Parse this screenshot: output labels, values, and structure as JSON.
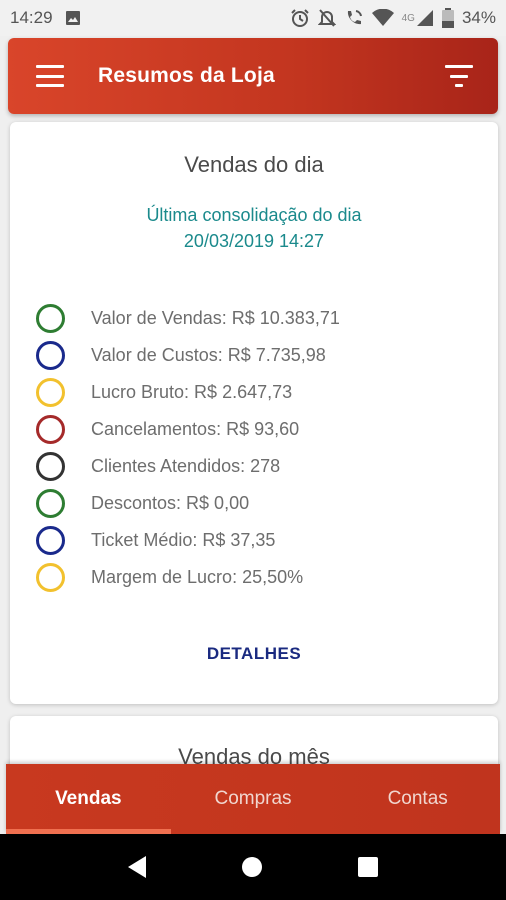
{
  "status_bar": {
    "time": "14:29",
    "battery": "34%",
    "network": "4G",
    "icons": [
      "image-icon",
      "alarm-icon",
      "notifications-off-icon",
      "wifi-call-icon",
      "wifi-icon",
      "signal-icon",
      "battery-icon"
    ]
  },
  "app_bar": {
    "title": "Resumos da Loja",
    "menu_icon": "menu-icon",
    "filter_icon": "filter-icon"
  },
  "daily_card": {
    "title": "Vendas do dia",
    "consolidation_label": "Última consolidação do dia",
    "consolidation_datetime": "20/03/2019 14:27",
    "metrics": [
      {
        "label": "Valor de Vendas: R$ 10.383,71",
        "color": "#2e7d32"
      },
      {
        "label": "Valor de Custos: R$ 7.735,98",
        "color": "#1a2a8c"
      },
      {
        "label": "Lucro Bruto: R$ 2.647,73",
        "color": "#f2c12e"
      },
      {
        "label": "Cancelamentos: R$ 93,60",
        "color": "#a52a2a"
      },
      {
        "label": "Clientes Atendidos: 278",
        "color": "#333333"
      },
      {
        "label": "Descontos: R$ 0,00",
        "color": "#2e7d32"
      },
      {
        "label": "Ticket Médio: R$ 37,35",
        "color": "#1a2a8c"
      },
      {
        "label": "Margem de Lucro: 25,50%",
        "color": "#f2c12e"
      }
    ],
    "details_button": "DETALHES"
  },
  "monthly_card": {
    "title": "Vendas do mês"
  },
  "bottom_nav": {
    "tabs": [
      {
        "label": "Vendas",
        "active": true
      },
      {
        "label": "Compras",
        "active": false
      },
      {
        "label": "Contas",
        "active": false
      }
    ]
  },
  "colors": {
    "accent": "#c8391f",
    "teal_text": "#1b8a8c",
    "link_blue": "#1a2a80"
  }
}
